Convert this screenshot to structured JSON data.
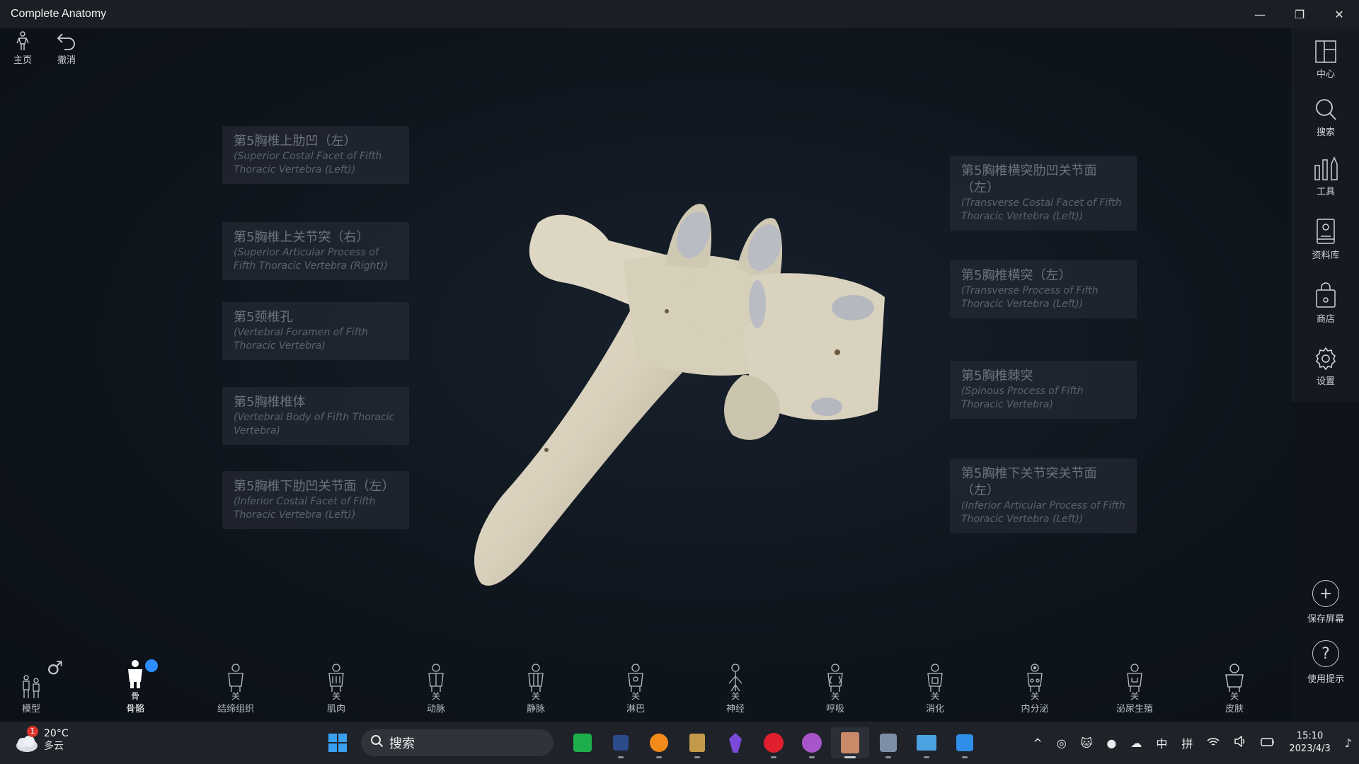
{
  "window": {
    "title": "Complete Anatomy",
    "minimize_glyph": "—",
    "restore_glyph": "❐",
    "close_glyph": "✕"
  },
  "top_left": {
    "home_label": "主页",
    "undo_label": "撤消"
  },
  "right_panel": {
    "items": [
      {
        "label": "中心",
        "icon": "layout-icon"
      },
      {
        "label": "搜索",
        "icon": "search-icon"
      },
      {
        "label": "工具",
        "icon": "tools-icon"
      },
      {
        "label": "资料库",
        "icon": "library-icon"
      },
      {
        "label": "商店",
        "icon": "store-icon"
      },
      {
        "label": "设置",
        "icon": "gear-icon"
      }
    ],
    "save_screen_label": "保存屏幕",
    "save_screen_glyph": "+",
    "help_label": "使用提示",
    "help_glyph": "?"
  },
  "labels_left": [
    {
      "zh": "第5胸椎上肋凹（左）",
      "en": "(Superior Costal Facet of Fifth Thoracic Vertebra (Left))"
    },
    {
      "zh": "第5胸椎上关节突（右）",
      "en": "(Superior Articular Process of Fifth Thoracic Vertebra (Right))"
    },
    {
      "zh": "第5颈椎孔",
      "en": "(Vertebral Foramen of Fifth Thoracic Vertebra)"
    },
    {
      "zh": "第5胸椎椎体",
      "en": "(Vertebral Body of Fifth Thoracic Vertebra)"
    },
    {
      "zh": "第5胸椎下肋凹关节面（左）",
      "en": "(Inferior Costal Facet of Fifth Thoracic Vertebra (Left))"
    }
  ],
  "labels_right": [
    {
      "zh": "第5胸椎横突肋凹关节面（左）",
      "en": "(Transverse Costal Facet of Fifth Thoracic Vertebra (Left))"
    },
    {
      "zh": "第5胸椎横突（左）",
      "en": "(Transverse Process of Fifth Thoracic Vertebra (Left))"
    },
    {
      "zh": "第5胸椎棘突",
      "en": "(Spinous Process of Fifth Thoracic Vertebra)"
    },
    {
      "zh": "第5胸椎下关节突关节面（左）",
      "en": "(Inferior Articular Process of Fifth Thoracic Vertebra (Left))"
    }
  ],
  "bottom_systems": {
    "model_label": "模型",
    "gender_glyph": "♂",
    "systems": [
      {
        "label": "骨骼",
        "sub": "骨",
        "active": true
      },
      {
        "label": "结缔组织",
        "sub": "关"
      },
      {
        "label": "肌肉",
        "sub": "关"
      },
      {
        "label": "动脉",
        "sub": "关"
      },
      {
        "label": "静脉",
        "sub": "关"
      },
      {
        "label": "淋巴",
        "sub": "关"
      },
      {
        "label": "神经",
        "sub": "关"
      },
      {
        "label": "呼吸",
        "sub": "关"
      },
      {
        "label": "消化",
        "sub": "关"
      },
      {
        "label": "内分泌",
        "sub": "关"
      },
      {
        "label": "泌尿生殖",
        "sub": "关"
      },
      {
        "label": "皮肤",
        "sub": "关"
      }
    ]
  },
  "taskbar": {
    "weather_badge": "1",
    "temperature": "20°C",
    "weather_desc": "多云",
    "search_placeholder": "搜索",
    "tray_ime_1": "中",
    "tray_ime_2": "拼",
    "time": "15:10",
    "date": "2023/4/3",
    "chevron_glyph": "^"
  },
  "colors": {
    "background": "#0f141c",
    "bone": "#ddd6c4",
    "accent_badge": "#2d8cff"
  }
}
